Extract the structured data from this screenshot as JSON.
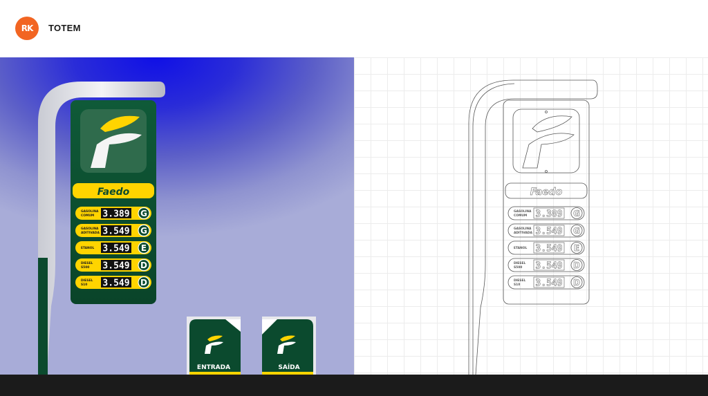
{
  "header": {
    "logo_text": "RK",
    "title": "TOTEM"
  },
  "totem": {
    "brand": "Faedo",
    "rows": [
      {
        "label_line1": "GASOLINA",
        "label_line2": "COMUM",
        "price": "3.389",
        "letter": "G"
      },
      {
        "label_line1": "GASOLINA",
        "label_line2": "ADITIVADA",
        "price": "3.549",
        "letter": "G"
      },
      {
        "label_line1": "ETANOL",
        "label_line2": "",
        "price": "3.549",
        "letter": "E"
      },
      {
        "label_line1": "DIESEL",
        "label_line2": "S500",
        "price": "3.549",
        "letter": "D"
      },
      {
        "label_line1": "DIESEL",
        "label_line2": "S10",
        "price": "3.549",
        "letter": "D"
      }
    ]
  },
  "signs": {
    "entrada": "ENTRADA",
    "saida": "SAÍDA"
  },
  "colors": {
    "brand_green": "#0b4a2e",
    "brand_yellow": "#ffd400",
    "logo_orange": "#f26522"
  }
}
